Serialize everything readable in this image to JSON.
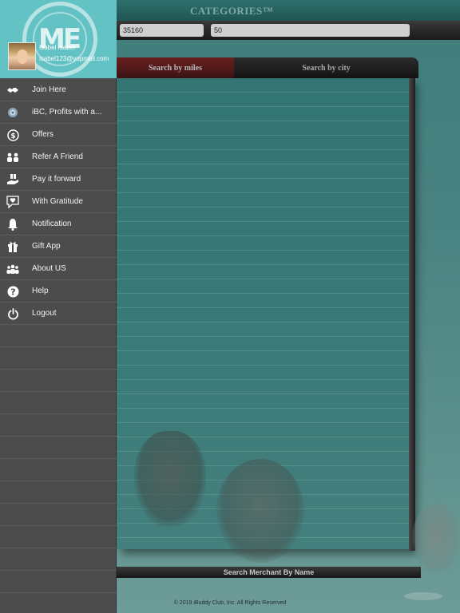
{
  "header": {
    "categories_title": "CATEGORIES™"
  },
  "filters": {
    "zip_value": "35160",
    "miles_value": "50"
  },
  "tabs": [
    {
      "label": "Search by miles"
    },
    {
      "label": "Search by city"
    }
  ],
  "search_merchant_label": "Search Merchant By Name",
  "footer": {
    "copyright": "© 2019 iBuddy Club, Inc. All Rights Reserved"
  },
  "drawer": {
    "logo_text": "ME",
    "user": {
      "name": "Isabel Isabel",
      "email": "isabel123@yopmail.com"
    },
    "items": [
      {
        "label": "Join Here",
        "icon": "handshake-icon"
      },
      {
        "label": "iBC, Profits with a...",
        "icon": "ibc-globe-icon"
      },
      {
        "label": "Offers",
        "icon": "dollar-icon"
      },
      {
        "label": "Refer A Friend",
        "icon": "people-pair-icon"
      },
      {
        "label": "Pay it forward",
        "icon": "gift-hand-icon"
      },
      {
        "label": "With Gratitude",
        "icon": "heart-message-icon"
      },
      {
        "label": "Notification",
        "icon": "bell-icon"
      },
      {
        "label": "Gift App",
        "icon": "gift-icon"
      },
      {
        "label": "About US",
        "icon": "group-icon"
      },
      {
        "label": "Help",
        "icon": "question-icon"
      },
      {
        "label": "Logout",
        "icon": "power-icon"
      }
    ],
    "colors": {
      "header_bg": "#63c2c4",
      "menu_bg": "#4c4c4c"
    }
  }
}
